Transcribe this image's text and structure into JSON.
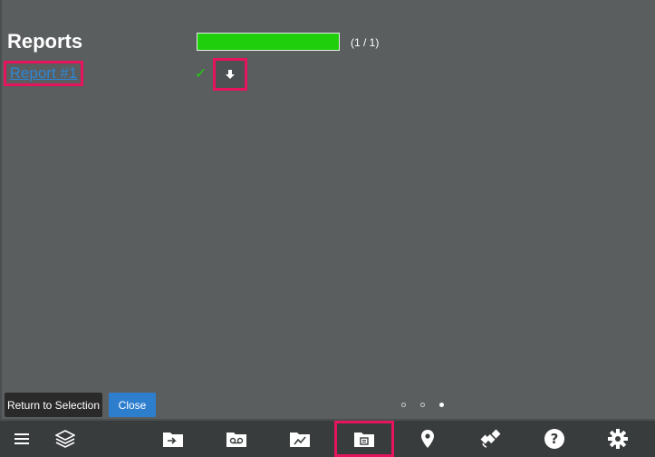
{
  "reports": {
    "title": "Reports",
    "progress_text": "(1 / 1)",
    "progress_fraction": 1.0,
    "items": [
      {
        "label": "Report #1",
        "status": "complete"
      }
    ]
  },
  "footer": {
    "return_label": "Return to Selection",
    "close_label": "Close",
    "pages": {
      "count": 3,
      "active": 3
    }
  },
  "toolbar": {
    "icons": [
      "menu-icon",
      "layers-icon",
      "folder-import-icon",
      "folder-voicemail-icon",
      "folder-chart-icon",
      "folder-report-icon",
      "location-pin-icon",
      "satellite-icon",
      "help-icon",
      "settings-icon"
    ],
    "active": "folder-report-icon"
  },
  "colors": {
    "panel": "#5a5e5f",
    "toolbar": "#393c3d",
    "progress": "#1fcf0c",
    "highlight": "#e5145c",
    "link": "#2e87d3",
    "close_button": "#2d7fce"
  }
}
